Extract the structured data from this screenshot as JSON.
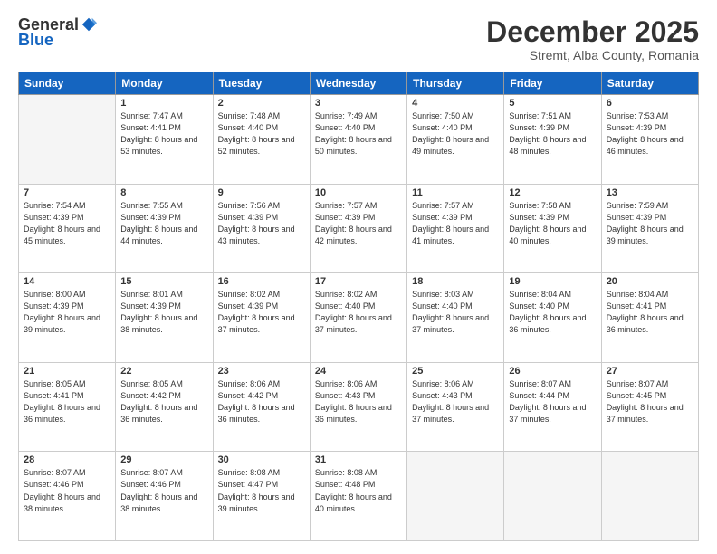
{
  "header": {
    "logo_general": "General",
    "logo_blue": "Blue",
    "month": "December 2025",
    "location": "Stremt, Alba County, Romania"
  },
  "weekdays": [
    "Sunday",
    "Monday",
    "Tuesday",
    "Wednesday",
    "Thursday",
    "Friday",
    "Saturday"
  ],
  "weeks": [
    [
      {
        "day": "",
        "empty": true
      },
      {
        "day": "1",
        "sunrise": "7:47 AM",
        "sunset": "4:41 PM",
        "daylight": "8 hours and 53 minutes."
      },
      {
        "day": "2",
        "sunrise": "7:48 AM",
        "sunset": "4:40 PM",
        "daylight": "8 hours and 52 minutes."
      },
      {
        "day": "3",
        "sunrise": "7:49 AM",
        "sunset": "4:40 PM",
        "daylight": "8 hours and 50 minutes."
      },
      {
        "day": "4",
        "sunrise": "7:50 AM",
        "sunset": "4:40 PM",
        "daylight": "8 hours and 49 minutes."
      },
      {
        "day": "5",
        "sunrise": "7:51 AM",
        "sunset": "4:39 PM",
        "daylight": "8 hours and 48 minutes."
      },
      {
        "day": "6",
        "sunrise": "7:53 AM",
        "sunset": "4:39 PM",
        "daylight": "8 hours and 46 minutes."
      }
    ],
    [
      {
        "day": "7",
        "sunrise": "7:54 AM",
        "sunset": "4:39 PM",
        "daylight": "8 hours and 45 minutes."
      },
      {
        "day": "8",
        "sunrise": "7:55 AM",
        "sunset": "4:39 PM",
        "daylight": "8 hours and 44 minutes."
      },
      {
        "day": "9",
        "sunrise": "7:56 AM",
        "sunset": "4:39 PM",
        "daylight": "8 hours and 43 minutes."
      },
      {
        "day": "10",
        "sunrise": "7:57 AM",
        "sunset": "4:39 PM",
        "daylight": "8 hours and 42 minutes."
      },
      {
        "day": "11",
        "sunrise": "7:57 AM",
        "sunset": "4:39 PM",
        "daylight": "8 hours and 41 minutes."
      },
      {
        "day": "12",
        "sunrise": "7:58 AM",
        "sunset": "4:39 PM",
        "daylight": "8 hours and 40 minutes."
      },
      {
        "day": "13",
        "sunrise": "7:59 AM",
        "sunset": "4:39 PM",
        "daylight": "8 hours and 39 minutes."
      }
    ],
    [
      {
        "day": "14",
        "sunrise": "8:00 AM",
        "sunset": "4:39 PM",
        "daylight": "8 hours and 39 minutes."
      },
      {
        "day": "15",
        "sunrise": "8:01 AM",
        "sunset": "4:39 PM",
        "daylight": "8 hours and 38 minutes."
      },
      {
        "day": "16",
        "sunrise": "8:02 AM",
        "sunset": "4:39 PM",
        "daylight": "8 hours and 37 minutes."
      },
      {
        "day": "17",
        "sunrise": "8:02 AM",
        "sunset": "4:40 PM",
        "daylight": "8 hours and 37 minutes."
      },
      {
        "day": "18",
        "sunrise": "8:03 AM",
        "sunset": "4:40 PM",
        "daylight": "8 hours and 37 minutes."
      },
      {
        "day": "19",
        "sunrise": "8:04 AM",
        "sunset": "4:40 PM",
        "daylight": "8 hours and 36 minutes."
      },
      {
        "day": "20",
        "sunrise": "8:04 AM",
        "sunset": "4:41 PM",
        "daylight": "8 hours and 36 minutes."
      }
    ],
    [
      {
        "day": "21",
        "sunrise": "8:05 AM",
        "sunset": "4:41 PM",
        "daylight": "8 hours and 36 minutes."
      },
      {
        "day": "22",
        "sunrise": "8:05 AM",
        "sunset": "4:42 PM",
        "daylight": "8 hours and 36 minutes."
      },
      {
        "day": "23",
        "sunrise": "8:06 AM",
        "sunset": "4:42 PM",
        "daylight": "8 hours and 36 minutes."
      },
      {
        "day": "24",
        "sunrise": "8:06 AM",
        "sunset": "4:43 PM",
        "daylight": "8 hours and 36 minutes."
      },
      {
        "day": "25",
        "sunrise": "8:06 AM",
        "sunset": "4:43 PM",
        "daylight": "8 hours and 37 minutes."
      },
      {
        "day": "26",
        "sunrise": "8:07 AM",
        "sunset": "4:44 PM",
        "daylight": "8 hours and 37 minutes."
      },
      {
        "day": "27",
        "sunrise": "8:07 AM",
        "sunset": "4:45 PM",
        "daylight": "8 hours and 37 minutes."
      }
    ],
    [
      {
        "day": "28",
        "sunrise": "8:07 AM",
        "sunset": "4:46 PM",
        "daylight": "8 hours and 38 minutes."
      },
      {
        "day": "29",
        "sunrise": "8:07 AM",
        "sunset": "4:46 PM",
        "daylight": "8 hours and 38 minutes."
      },
      {
        "day": "30",
        "sunrise": "8:08 AM",
        "sunset": "4:47 PM",
        "daylight": "8 hours and 39 minutes."
      },
      {
        "day": "31",
        "sunrise": "8:08 AM",
        "sunset": "4:48 PM",
        "daylight": "8 hours and 40 minutes."
      },
      {
        "day": "",
        "empty": true
      },
      {
        "day": "",
        "empty": true
      },
      {
        "day": "",
        "empty": true
      }
    ]
  ]
}
